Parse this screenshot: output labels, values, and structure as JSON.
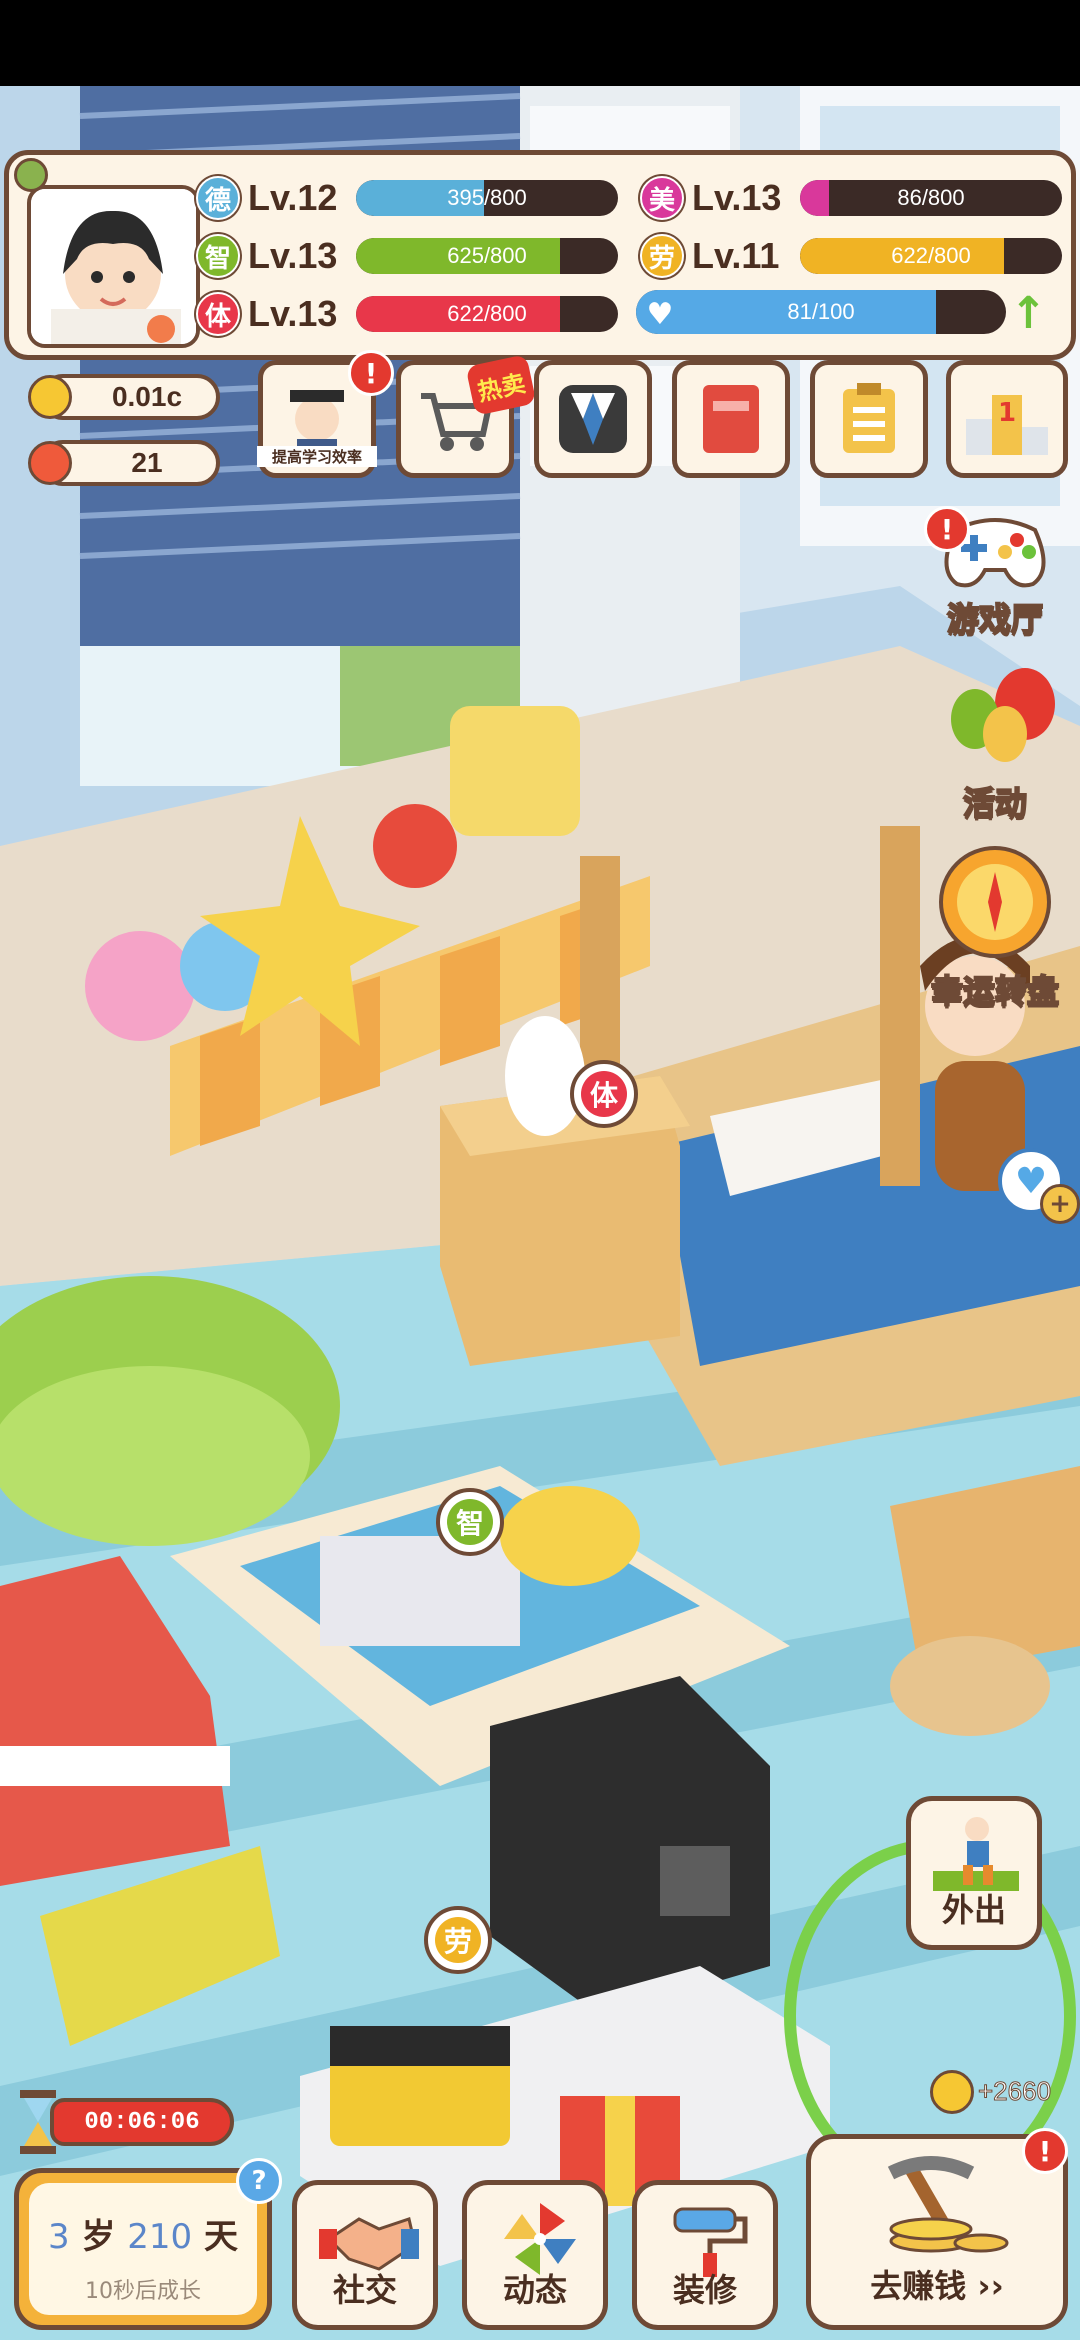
{
  "stats": {
    "de": {
      "icon_char": "德",
      "level": "Lv.12",
      "value": "395/800",
      "fraction": 0.49,
      "color": "#5ab0d9"
    },
    "zhi": {
      "icon_char": "智",
      "level": "Lv.13",
      "value": "625/800",
      "fraction": 0.78,
      "color": "#7fb82b"
    },
    "ti": {
      "icon_char": "体",
      "level": "Lv.13",
      "value": "622/800",
      "fraction": 0.78,
      "color": "#e8374a"
    },
    "mei": {
      "icon_char": "美",
      "level": "Lv.13",
      "value": "86/800",
      "fraction": 0.11,
      "color": "#d9389b"
    },
    "lao": {
      "icon_char": "劳",
      "level": "Lv.11",
      "value": "622/800",
      "fraction": 0.78,
      "color": "#f0b324"
    },
    "heart": {
      "value": "81/100",
      "fraction": 0.81,
      "color": "#55a9e6"
    }
  },
  "currency": {
    "coins": "0.01c",
    "flowers": "21"
  },
  "toolbar": {
    "study_label": "提高学习效率",
    "hot_label": "热卖",
    "rank_number": "1"
  },
  "side_menu": {
    "game_hall": "游戏厅",
    "activity": "活动",
    "lucky_wheel": "幸运转盘"
  },
  "scene_bubbles": {
    "ti": "体",
    "zhi": "智",
    "lao": "劳"
  },
  "outing": {
    "label": "外出",
    "reward": "+2660"
  },
  "timer": "00:06:06",
  "age": {
    "years": "3",
    "year_unit": "岁",
    "days": "210",
    "day_unit": "天",
    "grow_hint": "10秒后成长"
  },
  "bottom_nav": {
    "social": "社交",
    "moments": "动态",
    "decorate": "装修",
    "earn": "去赚钱 ››"
  },
  "alert_mark": "!",
  "help_mark": "?"
}
